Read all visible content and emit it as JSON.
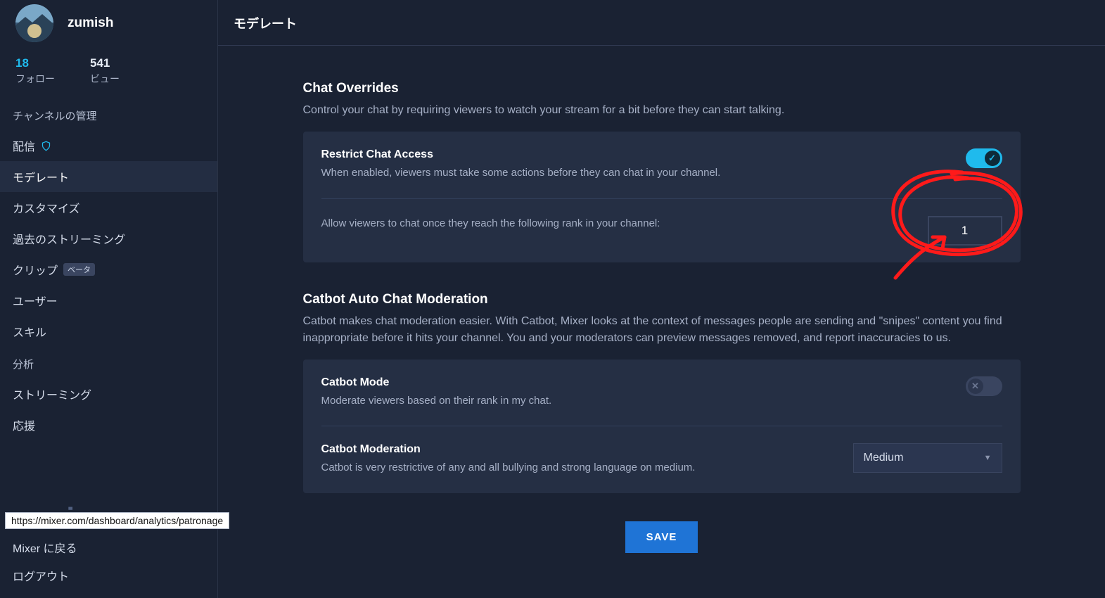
{
  "user": {
    "name": "zumish"
  },
  "stats": {
    "followers_count": "18",
    "followers_label": "フォロー",
    "views_count": "541",
    "views_label": "ビュー"
  },
  "nav": {
    "group_label": "チャンネルの管理",
    "items": {
      "broadcast": "配信",
      "moderate": "モデレート",
      "customize": "カスタマイズ",
      "vods": "過去のストリーミング",
      "clips": "クリップ",
      "clips_badge": "ベータ",
      "users": "ユーザー",
      "skills": "スキル"
    },
    "group2_label": "分析",
    "items2": {
      "streaming": "ストリーミング",
      "patronage": "応援"
    },
    "back": "Mixer に戻る",
    "logout": "ログアウト"
  },
  "logo": "mixer",
  "page": {
    "title": "モデレート"
  },
  "chat_overrides": {
    "title": "Chat Overrides",
    "desc": "Control your chat by requiring viewers to watch your stream for a bit before they can start talking.",
    "restrict_title": "Restrict Chat Access",
    "restrict_desc": "When enabled, viewers must take some actions before they can chat in your channel.",
    "restrict_on": true,
    "rank_desc": "Allow viewers to chat once they reach the following rank in your channel:",
    "rank_value": "1"
  },
  "catbot": {
    "title": "Catbot Auto Chat Moderation",
    "desc": "Catbot makes chat moderation easier. With Catbot, Mixer looks at the context of messages people are sending and \"snipes\" content you find inappropriate before it hits your channel. You and your moderators can preview messages removed, and report inaccuracies to us.",
    "mode_title": "Catbot Mode",
    "mode_desc": "Moderate viewers based on their rank in my chat.",
    "mode_on": false,
    "moderation_title": "Catbot Moderation",
    "moderation_desc": "Catbot is very restrictive of any and all bullying and strong language on medium.",
    "moderation_value": "Medium"
  },
  "save_label": "SAVE",
  "status_url": "https://mixer.com/dashboard/analytics/patronage"
}
